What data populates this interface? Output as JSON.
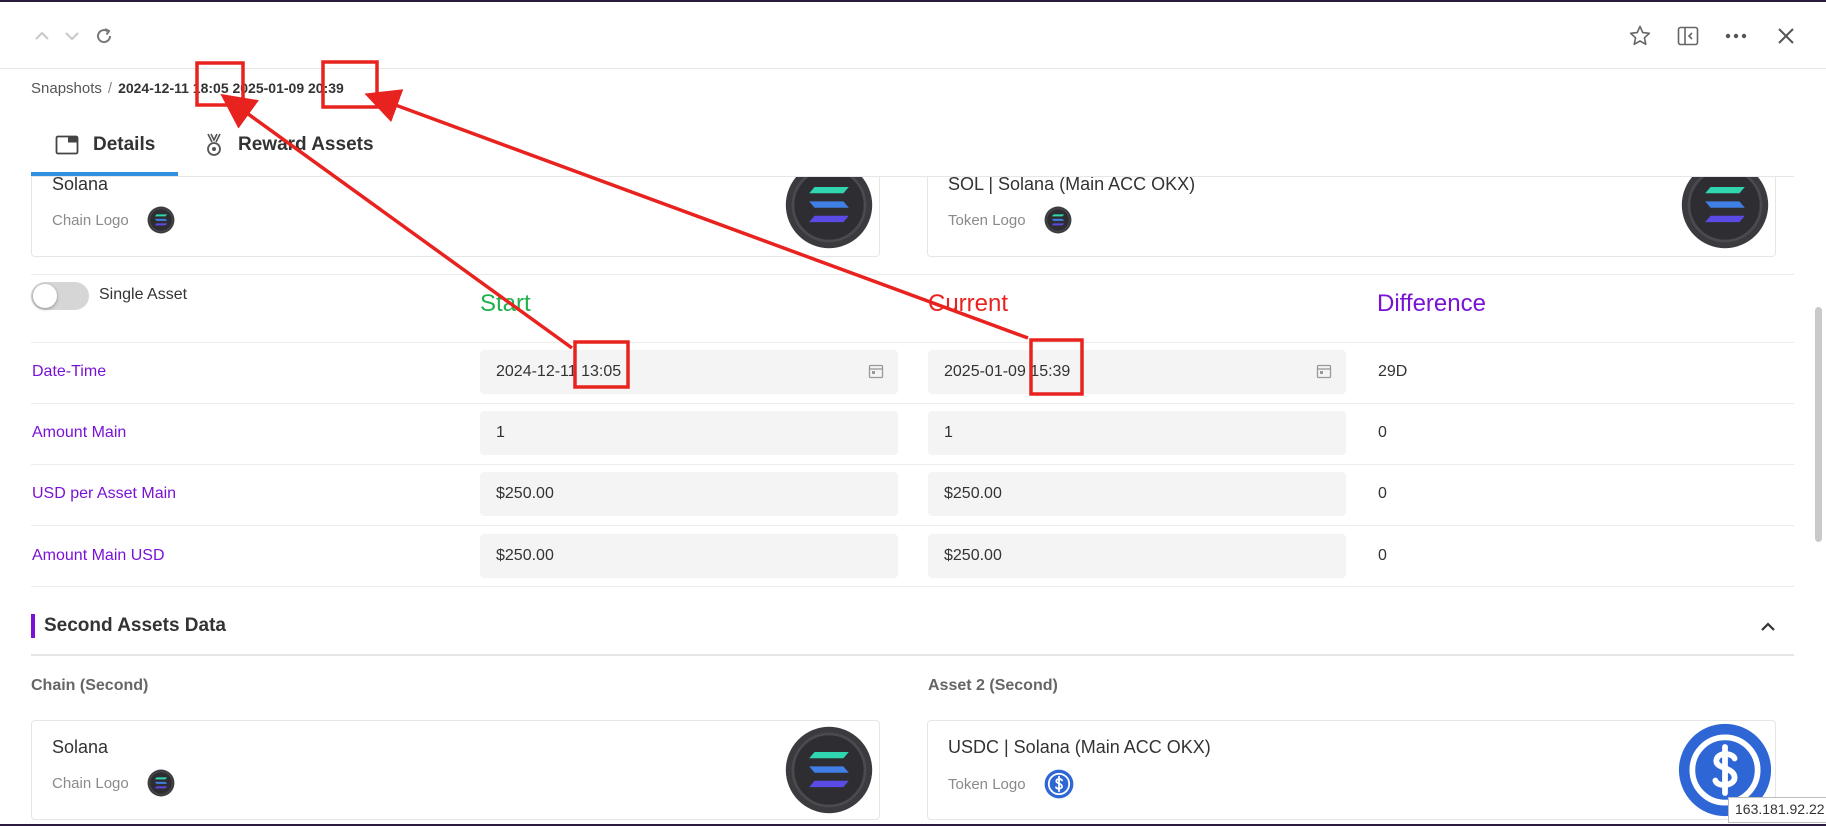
{
  "toolbar": {
    "icons": [
      "chevron-up-icon",
      "chevron-down-icon",
      "refresh-icon",
      "star-icon",
      "sidebar-icon",
      "more-icon",
      "close-icon"
    ]
  },
  "breadcrumb": {
    "root": "Snapshots",
    "separator": "/",
    "current": "2024-12-11 18:05 2025-01-09 20:39"
  },
  "tabs": [
    {
      "label": "Details",
      "icon": "window-icon",
      "active": true
    },
    {
      "label": "Reward Assets",
      "icon": "medal-icon",
      "active": false
    }
  ],
  "main_cards": {
    "chain": {
      "title": "Solana",
      "logo_label": "Chain Logo",
      "logo": "solana-logo"
    },
    "token": {
      "title": "SOL | Solana (Main ACC OKX)",
      "logo_label": "Token Logo",
      "logo": "solana-logo"
    }
  },
  "single_asset": {
    "label": "Single Asset",
    "on": false
  },
  "columns": {
    "start": "Start",
    "current": "Current",
    "difference": "Difference",
    "colors": {
      "start": "#22b14c",
      "current": "#e8231f",
      "difference": "#7a12d6"
    }
  },
  "rows": [
    {
      "label": "Date-Time",
      "start": "2024-12-11 13:05",
      "current": "2025-01-09 15:39",
      "difference": "29D",
      "has_calendar": true
    },
    {
      "label": "Amount Main",
      "start": "1",
      "current": "1",
      "difference": "0"
    },
    {
      "label": "USD per Asset Main",
      "start": "$250.00",
      "current": "$250.00",
      "difference": "0"
    },
    {
      "label": "Amount Main USD",
      "start": "$250.00",
      "current": "$250.00",
      "difference": "0"
    }
  ],
  "second_section": {
    "title": "Second Assets Data",
    "chain_caption": "Chain (Second)",
    "asset_caption": "Asset 2 (Second)",
    "chain_card": {
      "title": "Solana",
      "logo_label": "Chain Logo",
      "logo": "solana-logo"
    },
    "asset_card": {
      "title": "USDC | Solana (Main ACC OKX)",
      "logo_label": "Token Logo",
      "logo": "usdc-logo"
    }
  },
  "ip_tooltip": "163.181.92.22",
  "annotation_color": "#e8231f"
}
